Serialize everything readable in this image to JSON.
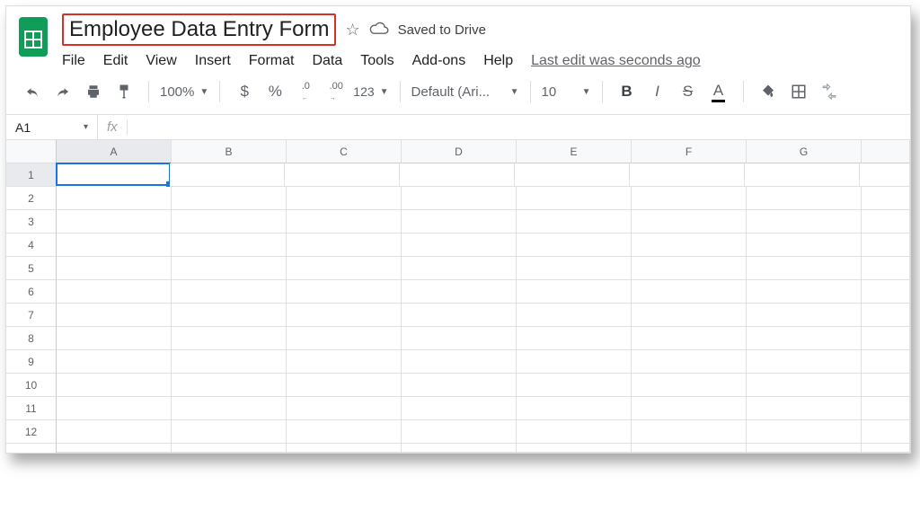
{
  "doc": {
    "title": "Employee Data Entry Form",
    "saved_text": "Saved to Drive",
    "last_edit": "Last edit was seconds ago"
  },
  "menu": {
    "file": "File",
    "edit": "Edit",
    "view": "View",
    "insert": "Insert",
    "format": "Format",
    "data": "Data",
    "tools": "Tools",
    "addons": "Add-ons",
    "help": "Help"
  },
  "toolbar": {
    "zoom": "100%",
    "currency": "$",
    "percent": "%",
    "dec_dec": ".0",
    "inc_dec": ".00",
    "more_formats": "123",
    "font": "Default (Ari...",
    "font_size": "10",
    "bold": "B",
    "italic": "I",
    "strike": "S",
    "text_color": "A"
  },
  "namebox": {
    "ref": "A1",
    "fx": "fx"
  },
  "columns": [
    "A",
    "B",
    "C",
    "D",
    "E",
    "F",
    "G"
  ],
  "rows": [
    "1",
    "2",
    "3",
    "4",
    "5",
    "6",
    "7",
    "8",
    "9",
    "10",
    "11",
    "12"
  ]
}
